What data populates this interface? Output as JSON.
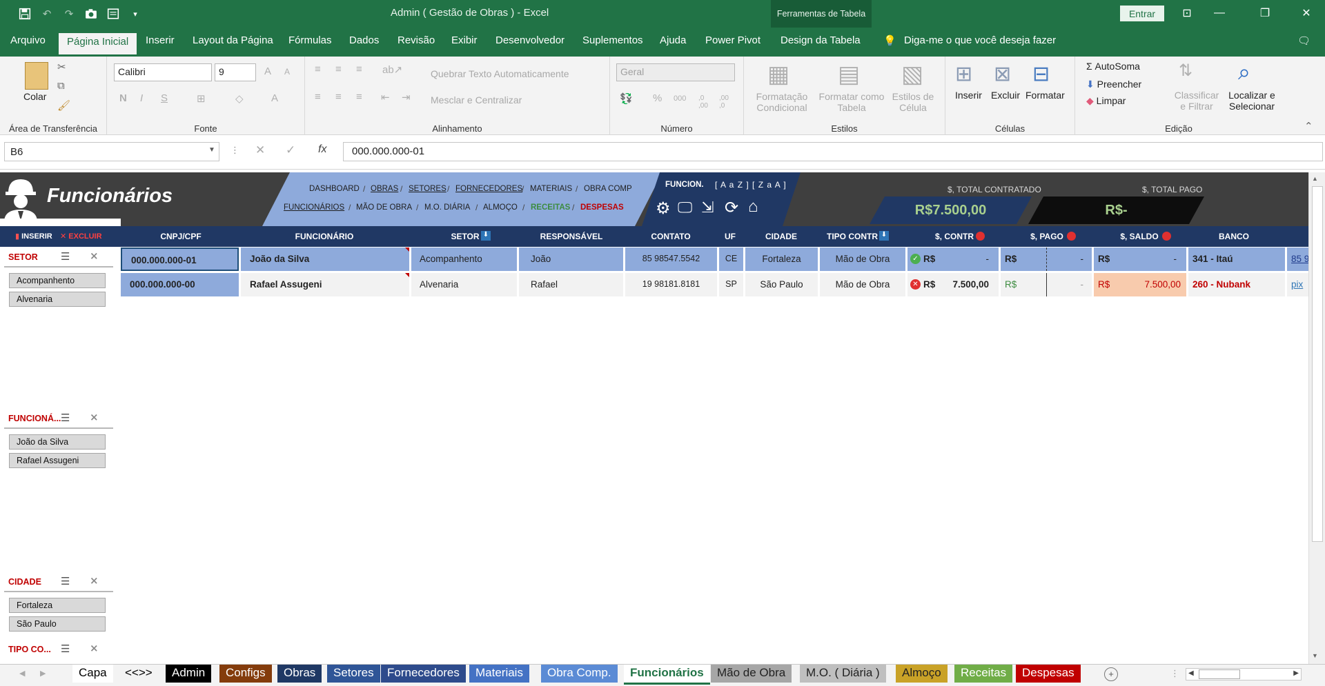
{
  "window": {
    "title": "Admin ( Gestão de Obras ) - Excel",
    "tools_band": "Ferramentas de Tabela",
    "signin": "Entrar"
  },
  "menu": {
    "tabs": [
      "Arquivo",
      "Página Inicial",
      "Inserir",
      "Layout da Página",
      "Fórmulas",
      "Dados",
      "Revisão",
      "Exibir",
      "Desenvolvedor",
      "Suplementos",
      "Ajuda",
      "Power Pivot",
      "Design da Tabela"
    ],
    "active": "Página Inicial",
    "tell_me": "Diga-me o que você deseja fazer"
  },
  "ribbon": {
    "clipboard": {
      "label": "Área de Transferência",
      "paste": "Colar"
    },
    "font": {
      "label": "Fonte",
      "font_name": "Calibri",
      "font_size": "9",
      "bold": "N",
      "italic": "I",
      "underline": "S",
      "grow": "A",
      "shrink": "A",
      "color": "A"
    },
    "alignment": {
      "label": "Alinhamento",
      "wrap": "Quebrar Texto Automaticamente",
      "merge": "Mesclar e Centralizar"
    },
    "number": {
      "label": "Número",
      "format": "Geral",
      "percent": "%",
      "thousands": "000",
      "inc_dec": ",0 ,00",
      "dec_dec": ",00 ,0"
    },
    "styles": {
      "label": "Estilos",
      "conditional": [
        "Formatação",
        "Condicional"
      ],
      "as_table": [
        "Formatar como",
        "Tabela"
      ],
      "cell_styles": [
        "Estilos de",
        "Célula"
      ]
    },
    "cells": {
      "label": "Células",
      "insert": "Inserir",
      "delete": "Excluir",
      "format": "Formatar"
    },
    "editing": {
      "label": "Edição",
      "autosum": "AutoSoma",
      "fill": "Preencher",
      "clear": "Limpar",
      "sort": [
        "Classificar",
        "e Filtrar"
      ],
      "find": [
        "Localizar e",
        "Selecionar"
      ]
    }
  },
  "formula_bar": {
    "name_box": "B6",
    "fx": "fx",
    "value": "000.000.000-01"
  },
  "sheet": {
    "title": "Funcionários",
    "insert": "INSERIR",
    "delete": "EXCLUIR",
    "nav_row1": [
      "DASHBOARD",
      "OBRAS",
      "SETORES",
      "FORNECEDORES",
      "MATERIAIS",
      "OBRA COMP"
    ],
    "nav_row2": [
      "FUNCIONÁRIOS",
      "MÃO DE OBRA",
      "M.O. DIÁRIA",
      "ALMOÇO",
      "RECEITAS",
      "DESPESAS"
    ],
    "sort_label": "FUNCION.",
    "sort_buttons": "[ A a Z ] [ Z a A ]",
    "total_contratado_label": "$, TOTAL CONTRATADO",
    "total_contratado": "R$7.500,00",
    "total_pago_label": "$, TOTAL PAGO",
    "total_pago": "R$-",
    "columns": [
      "CNPJ/CPF",
      "FUNCIONÁRIO",
      "SETOR",
      "RESPONSÁVEL",
      "CONTATO",
      "UF",
      "CIDADE",
      "TIPO CONTR",
      "$, CONTR",
      "$, PAGO",
      "$, SALDO",
      "BANCO"
    ],
    "rows": [
      {
        "cpf": "000.000.000-01",
        "nome": "João da Silva",
        "setor": "Acompanhento",
        "resp": "João",
        "contato": "85 98547.5542",
        "uf": "CE",
        "cidade": "Fortaleza",
        "tipo": "Mão de Obra",
        "contr_cur": "R$",
        "contr": "-",
        "pago_cur": "R$",
        "pago": "-",
        "saldo_cur": "R$",
        "saldo": "-",
        "banco": "341 - Itaú",
        "extra": "85 9",
        "status": "ok"
      },
      {
        "cpf": "000.000.000-00",
        "nome": "Rafael Assugeni",
        "setor": "Alvenaria",
        "resp": "Rafael",
        "contato": "19 98181.8181",
        "uf": "SP",
        "cidade": "São Paulo",
        "tipo": "Mão de Obra",
        "contr_cur": "R$",
        "contr": "7.500,00",
        "pago_cur": "R$",
        "pago": "-",
        "saldo_cur": "R$",
        "saldo": "7.500,00",
        "banco": "260 - Nubank",
        "extra": "pix",
        "status": "err"
      }
    ],
    "slicers": [
      {
        "title": "SETOR",
        "items": [
          "Acompanhento",
          "Alvenaria"
        ]
      },
      {
        "title": "FUNCIONÁ...",
        "items": [
          "João da Silva",
          "Rafael Assugeni"
        ]
      },
      {
        "title": "CIDADE",
        "items": [
          "Fortaleza",
          "São Paulo"
        ]
      },
      {
        "title": "TIPO CO...",
        "items": []
      }
    ]
  },
  "sheet_tabs": [
    {
      "label": "Capa",
      "bg": "#ffffff",
      "fg": "#000000"
    },
    {
      "label": "<<>>",
      "bg": "#f3f3f3",
      "fg": "#000000"
    },
    {
      "label": "Admin",
      "bg": "#000000",
      "fg": "#ffffff"
    },
    {
      "label": "Configs",
      "bg": "#843c0c",
      "fg": "#ffffff"
    },
    {
      "label": "Obras",
      "bg": "#1f3864",
      "fg": "#ffffff"
    },
    {
      "label": "Setores",
      "bg": "#2f5597",
      "fg": "#ffffff"
    },
    {
      "label": "Fornecedores",
      "bg": "#2e4b8c",
      "fg": "#ffffff"
    },
    {
      "label": "Materiais",
      "bg": "#4472c4",
      "fg": "#ffffff"
    },
    {
      "label": "Obra Comp.",
      "bg": "#5b8bd5",
      "fg": "#ffffff"
    },
    {
      "label": "Funcionários",
      "bg": "#ffffff",
      "fg": "#217346"
    },
    {
      "label": "Mão de Obra",
      "bg": "#a6a6a6",
      "fg": "#222222"
    },
    {
      "label": "M.O. ( Diária )",
      "bg": "#bfbfbf",
      "fg": "#222222"
    },
    {
      "label": "Almoço",
      "bg": "#c9a227",
      "fg": "#222222"
    },
    {
      "label": "Receitas",
      "bg": "#70ad47",
      "fg": "#ffffff"
    },
    {
      "label": "Despesas",
      "bg": "#c00000",
      "fg": "#ffffff"
    }
  ],
  "colors": {
    "excel_green": "#217346",
    "header_navy": "#203864",
    "nav_blue": "#8eaadb",
    "row_blue": "#8eaadb",
    "row_gray": "#f2f2f2",
    "saldo_salmon": "#f8cbad",
    "money_green": "#a9d08e"
  }
}
